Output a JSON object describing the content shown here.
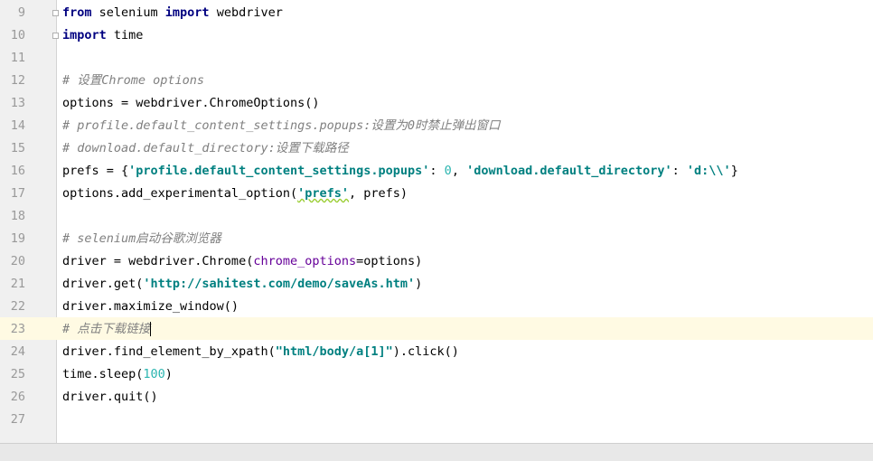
{
  "editor": {
    "lines": [
      {
        "num": "9",
        "tokens": [
          {
            "t": "from",
            "c": "kw"
          },
          {
            "t": " selenium ",
            "c": ""
          },
          {
            "t": "import",
            "c": "kw"
          },
          {
            "t": " webdriver",
            "c": ""
          }
        ],
        "fold": true
      },
      {
        "num": "10",
        "tokens": [
          {
            "t": "import",
            "c": "kw"
          },
          {
            "t": " time",
            "c": ""
          }
        ],
        "fold": true
      },
      {
        "num": "11",
        "tokens": []
      },
      {
        "num": "12",
        "tokens": [
          {
            "t": "# 设置Chrome options",
            "c": "cm"
          }
        ]
      },
      {
        "num": "13",
        "tokens": [
          {
            "t": "options = webdriver.ChromeOptions()",
            "c": ""
          }
        ]
      },
      {
        "num": "14",
        "tokens": [
          {
            "t": "# profile.default_content_settings.popups:设置为0时禁止弹出窗口",
            "c": "cm"
          }
        ]
      },
      {
        "num": "15",
        "tokens": [
          {
            "t": "# download.default_directory:设置下载路径",
            "c": "cm"
          }
        ]
      },
      {
        "num": "16",
        "tokens": [
          {
            "t": "prefs = {",
            "c": ""
          },
          {
            "t": "'profile.default_content_settings.popups'",
            "c": "str"
          },
          {
            "t": ": ",
            "c": ""
          },
          {
            "t": "0",
            "c": "num"
          },
          {
            "t": ", ",
            "c": ""
          },
          {
            "t": "'download.default_directory'",
            "c": "str"
          },
          {
            "t": ": ",
            "c": ""
          },
          {
            "t": "'d:\\\\'",
            "c": "str"
          },
          {
            "t": "}",
            "c": ""
          }
        ]
      },
      {
        "num": "17",
        "tokens": [
          {
            "t": "options.add_experimental_option(",
            "c": ""
          },
          {
            "t": "'prefs'",
            "c": "str squiggle"
          },
          {
            "t": ", prefs)",
            "c": ""
          }
        ]
      },
      {
        "num": "18",
        "tokens": []
      },
      {
        "num": "19",
        "tokens": [
          {
            "t": "# selenium启动谷歌浏览器",
            "c": "cm"
          }
        ]
      },
      {
        "num": "20",
        "tokens": [
          {
            "t": "driver = webdriver.Chrome(",
            "c": ""
          },
          {
            "t": "chrome_options",
            "c": "param"
          },
          {
            "t": "=options)",
            "c": ""
          }
        ]
      },
      {
        "num": "21",
        "tokens": [
          {
            "t": "driver.get(",
            "c": ""
          },
          {
            "t": "'http://sahitest.com/demo/saveAs.htm'",
            "c": "str"
          },
          {
            "t": ")",
            "c": ""
          }
        ]
      },
      {
        "num": "22",
        "tokens": [
          {
            "t": "driver.maximize_window()",
            "c": ""
          }
        ]
      },
      {
        "num": "23",
        "tokens": [
          {
            "t": "# 点击下载链接",
            "c": "cm"
          }
        ],
        "current": true
      },
      {
        "num": "24",
        "tokens": [
          {
            "t": "driver.find_element_by_xpath(",
            "c": ""
          },
          {
            "t": "\"html/body/a[1]\"",
            "c": "str"
          },
          {
            "t": ").click()",
            "c": ""
          }
        ]
      },
      {
        "num": "25",
        "tokens": [
          {
            "t": "time.sleep(",
            "c": ""
          },
          {
            "t": "100",
            "c": "num"
          },
          {
            "t": ")",
            "c": ""
          }
        ]
      },
      {
        "num": "26",
        "tokens": [
          {
            "t": "driver.quit()",
            "c": ""
          }
        ]
      },
      {
        "num": "27",
        "tokens": []
      }
    ],
    "colors": {
      "keyword": "#000080",
      "string": "#008080",
      "number": "#2bb5b0",
      "comment": "#808080",
      "param": "#660099",
      "current_line": "#fffae3",
      "gutter": "#f0f0f0"
    }
  }
}
